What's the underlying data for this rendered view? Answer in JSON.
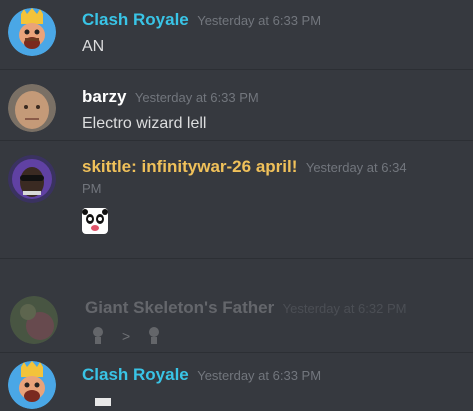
{
  "messages": [
    {
      "author": "Clash Royale",
      "author_color": "#39c4e6",
      "timestamp": "Yesterday at 6:33 PM",
      "text": "AN",
      "avatar": "clash-royale-king-avatar"
    },
    {
      "author": "barzy",
      "author_color": "#ffffff",
      "timestamp": "Yesterday at 6:33 PM",
      "text": "Electro wizard lell",
      "avatar": "meme-face-avatar"
    },
    {
      "author": "skittle: infinitywar-26 april!",
      "author_color": "#f0c15a",
      "timestamp_part1": "Yesterday at 6:34",
      "timestamp_part2": "PM",
      "avatar": "sunglasses-man-avatar",
      "emoji": "panda-face-emoji"
    },
    {
      "author": "Giant Skeleton's Father",
      "author_color": "#b9bbbe",
      "timestamp": "Yesterday at 6:32 PM",
      "separator": ">",
      "avatar": "blurry-avatar"
    },
    {
      "author": "Clash Royale",
      "author_color": "#39c4e6",
      "timestamp": "Yesterday at 6:33 PM",
      "avatar": "clash-royale-king-avatar"
    }
  ]
}
